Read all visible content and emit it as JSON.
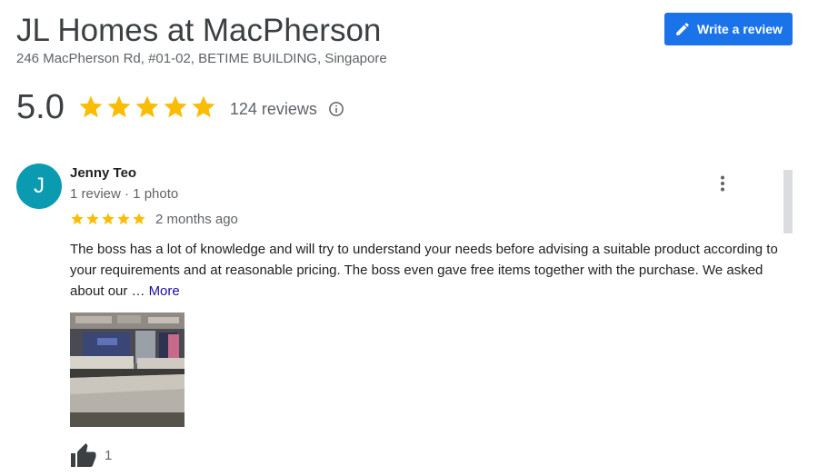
{
  "place": {
    "title": "JL Homes at MacPherson",
    "address": "246 MacPherson Rd, #01-02, BETIME BUILDING, Singapore"
  },
  "actions": {
    "write_review_label": "Write a review",
    "write_review_icon": "pencil-icon"
  },
  "rating": {
    "score": "5.0",
    "stars": 5,
    "count_label": "124 reviews",
    "info_icon": "info-icon",
    "star_color": "#fbbc04"
  },
  "review": {
    "avatar_initial": "J",
    "avatar_color": "#0a9bb0",
    "author": "Jenny Teo",
    "meta": "1 review · 1 photo",
    "stars": 5,
    "date": "2 months ago",
    "text": "The boss has a lot of knowledge and will try to understand your needs before advising a suitable product according to your requirements and at reasonable pricing. The boss even gave free items together with the purchase. We asked about our …",
    "more_label": "More",
    "photo_icon": "mattress-showroom-photo",
    "like_icon": "thumbs-up-icon",
    "like_count": "1",
    "menu_icon": "more-vert-icon"
  },
  "colors": {
    "accent": "#1a73e8",
    "link": "#1a0dab",
    "secondary_text": "#5f6368"
  }
}
